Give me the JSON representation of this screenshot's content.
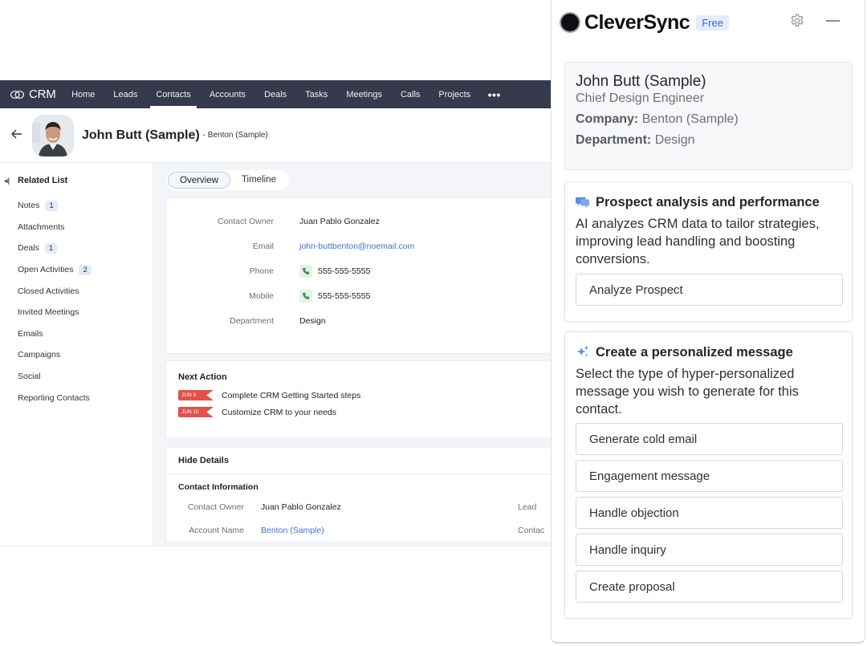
{
  "crm": {
    "brand": "CRM",
    "nav": [
      "Home",
      "Leads",
      "Contacts",
      "Accounts",
      "Deals",
      "Tasks",
      "Meetings",
      "Calls",
      "Projects"
    ],
    "nav_active": "Contacts",
    "more_label": "•••",
    "record": {
      "name": "John Butt (Sample)",
      "account_suffix": "- Benton (Sample)"
    },
    "related_list": {
      "title": "Related List",
      "items": [
        {
          "label": "Notes",
          "count": "1"
        },
        {
          "label": "Attachments",
          "count": null
        },
        {
          "label": "Deals",
          "count": "1"
        },
        {
          "label": "Open Activities",
          "count": "2"
        },
        {
          "label": "Closed Activities",
          "count": null
        },
        {
          "label": "Invited Meetings",
          "count": null
        },
        {
          "label": "Emails",
          "count": null
        },
        {
          "label": "Campaigns",
          "count": null
        },
        {
          "label": "Social",
          "count": null
        },
        {
          "label": "Reporting Contacts",
          "count": null
        }
      ]
    },
    "tabs": [
      {
        "label": "Overview",
        "active": true
      },
      {
        "label": "Timeline",
        "active": false
      }
    ],
    "overview": [
      {
        "label": "Contact Owner",
        "value": "Juan Pablo Gonzalez",
        "type": "text"
      },
      {
        "label": "Email",
        "value": "john-buttbenton@noemail.com",
        "type": "link"
      },
      {
        "label": "Phone",
        "value": "555-555-5555",
        "type": "phone"
      },
      {
        "label": "Mobile",
        "value": "555-555-5555",
        "type": "phone"
      },
      {
        "label": "Department",
        "value": "Design",
        "type": "text"
      }
    ],
    "next_action": {
      "title": "Next Action",
      "items": [
        {
          "date": "JUN 9",
          "text": "Complete CRM Getting Started steps"
        },
        {
          "date": "JUN 10",
          "text": "Customize CRM to your needs"
        }
      ]
    },
    "details": {
      "toggle_label": "Hide Details",
      "section_title": "Contact Information",
      "rows": [
        {
          "label": "Contact Owner",
          "value": "Juan Pablo Gonzalez",
          "type": "text",
          "right_label": "Lead"
        },
        {
          "label": "Account Name",
          "value": "Benton (Sample)",
          "type": "link",
          "right_label": "Contac"
        }
      ]
    }
  },
  "panel": {
    "app_name": "CleverSync",
    "plan_badge": "Free",
    "contact": {
      "name": "John Butt (Sample)",
      "title": "Chief Design Engineer",
      "company_label": "Company:",
      "company": "Benton (Sample)",
      "department_label": "Department:",
      "department": "Design"
    },
    "analysis": {
      "title": "Prospect analysis and performance",
      "description": "AI analyzes CRM data to tailor strategies, improving lead handling and boosting conversions.",
      "button": "Analyze Prospect"
    },
    "compose": {
      "title": "Create a personalized message",
      "description": "Select the type of hyper-personalized message you wish to generate for this contact.",
      "options": [
        "Generate cold email",
        "Engagement message",
        "Handle objection",
        "Handle inquiry",
        "Create proposal"
      ]
    },
    "colors": {
      "accent": "#5b8def",
      "plan_badge_bg": "#e4ecfb",
      "nav_bg": "#353b4c",
      "date_tag": "#e2524c",
      "link": "#3c74d8"
    }
  }
}
